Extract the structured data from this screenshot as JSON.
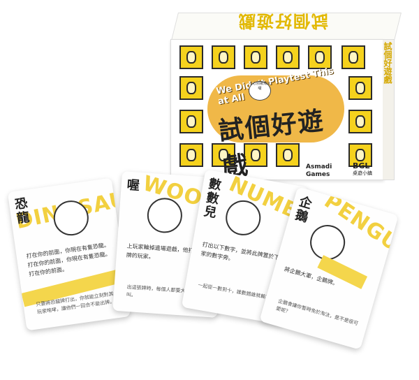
{
  "box": {
    "top_title": "試個好遊戲",
    "subtitle_en": "We Didn't Playtest This at All",
    "title_zh": "試個好遊戲",
    "bubble_text": "小心別被淘汰囉",
    "side_text": "試個好遊戲",
    "publisher": "Asmadi Games",
    "logo": "BGL",
    "logo_sub": "桌遊小鎮"
  },
  "cards": [
    {
      "name": "恐龍",
      "big_text": "DINOSAUR",
      "flavor": "只要將恐龍牌打出，你就能立刻對其他玩家咆哮，讓他們一回合不能出牌。"
    },
    {
      "name": "喔",
      "big_text": "WOOF!",
      "flavor": "出這張牌時，每個人都要大叫一聲狗叫。"
    },
    {
      "name": "數數兒",
      "big_text": "NUMBER",
      "flavor": "一起從一數到十，誰數錯誰就輸了吧。"
    },
    {
      "name": "企鵝",
      "big_text": "PENGUINS",
      "flavor": "企鵝會讓你暫時免於淘汰，是不是很可愛呢？"
    }
  ]
}
